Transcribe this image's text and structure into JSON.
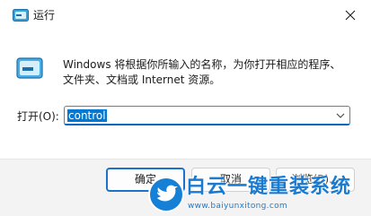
{
  "window": {
    "title": "运行",
    "close_icon": "close-icon"
  },
  "body": {
    "description_line1": "Windows 将根据你所输入的名称，为你打开相应的程序、",
    "description_line2": "文件夹、文档或 Internet 资源。",
    "open_label": "打开(O):",
    "open_value": "control"
  },
  "buttons": {
    "ok": "确定",
    "cancel": "取消",
    "browse": "浏览(B)..."
  },
  "watermark": {
    "title": "白云一键重装系统",
    "url": "www.baiyunxitong.com"
  },
  "colors": {
    "accent": "#0067c0",
    "selection": "#0078d4",
    "watermark": "#1a7ad0"
  }
}
